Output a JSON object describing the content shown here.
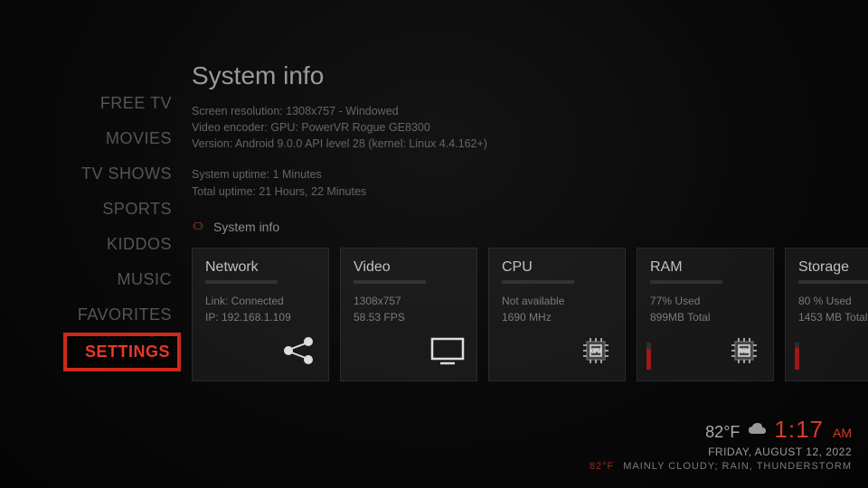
{
  "sidebar": {
    "items": [
      {
        "label": "FREE TV"
      },
      {
        "label": "MOVIES"
      },
      {
        "label": "TV SHOWS"
      },
      {
        "label": "SPORTS"
      },
      {
        "label": "KIDDOS"
      },
      {
        "label": "MUSIC"
      },
      {
        "label": "FAVORITES"
      },
      {
        "label": "SETTINGS"
      }
    ]
  },
  "main": {
    "title": "System info",
    "resolution": "Screen resolution: 1308x757 - Windowed",
    "encoder": "Video encoder: GPU: PowerVR Rogue GE8300",
    "version": "Version: Android 9.0.0 API level 28 (kernel: Linux 4.4.162+)",
    "sys_uptime": "System uptime: 1 Minutes",
    "total_uptime": "Total uptime: 21 Hours, 22 Minutes",
    "section_head": "System info"
  },
  "cards": {
    "network": {
      "title": "Network",
      "line1": "Link: Connected",
      "line2": "IP: 192.168.1.109"
    },
    "video": {
      "title": "Video",
      "line1": "1308x757",
      "line2": "58.53 FPS"
    },
    "cpu": {
      "title": "CPU",
      "line1": "Not available",
      "line2": "1690 MHz"
    },
    "ram": {
      "title": "RAM",
      "line1": "77% Used",
      "line2": "899MB Total",
      "pct": 77
    },
    "storage": {
      "title": "Storage",
      "line1": "80 % Used",
      "line2": "1453 MB Total",
      "pct": 80
    }
  },
  "footer": {
    "temp": "82°F",
    "time": "1:17",
    "ampm": "AM",
    "date": "FRIDAY, AUGUST 12, 2022",
    "temp2": "82°F",
    "cond": "MAINLY CLOUDY; RAIN, THUNDERSTORM"
  }
}
